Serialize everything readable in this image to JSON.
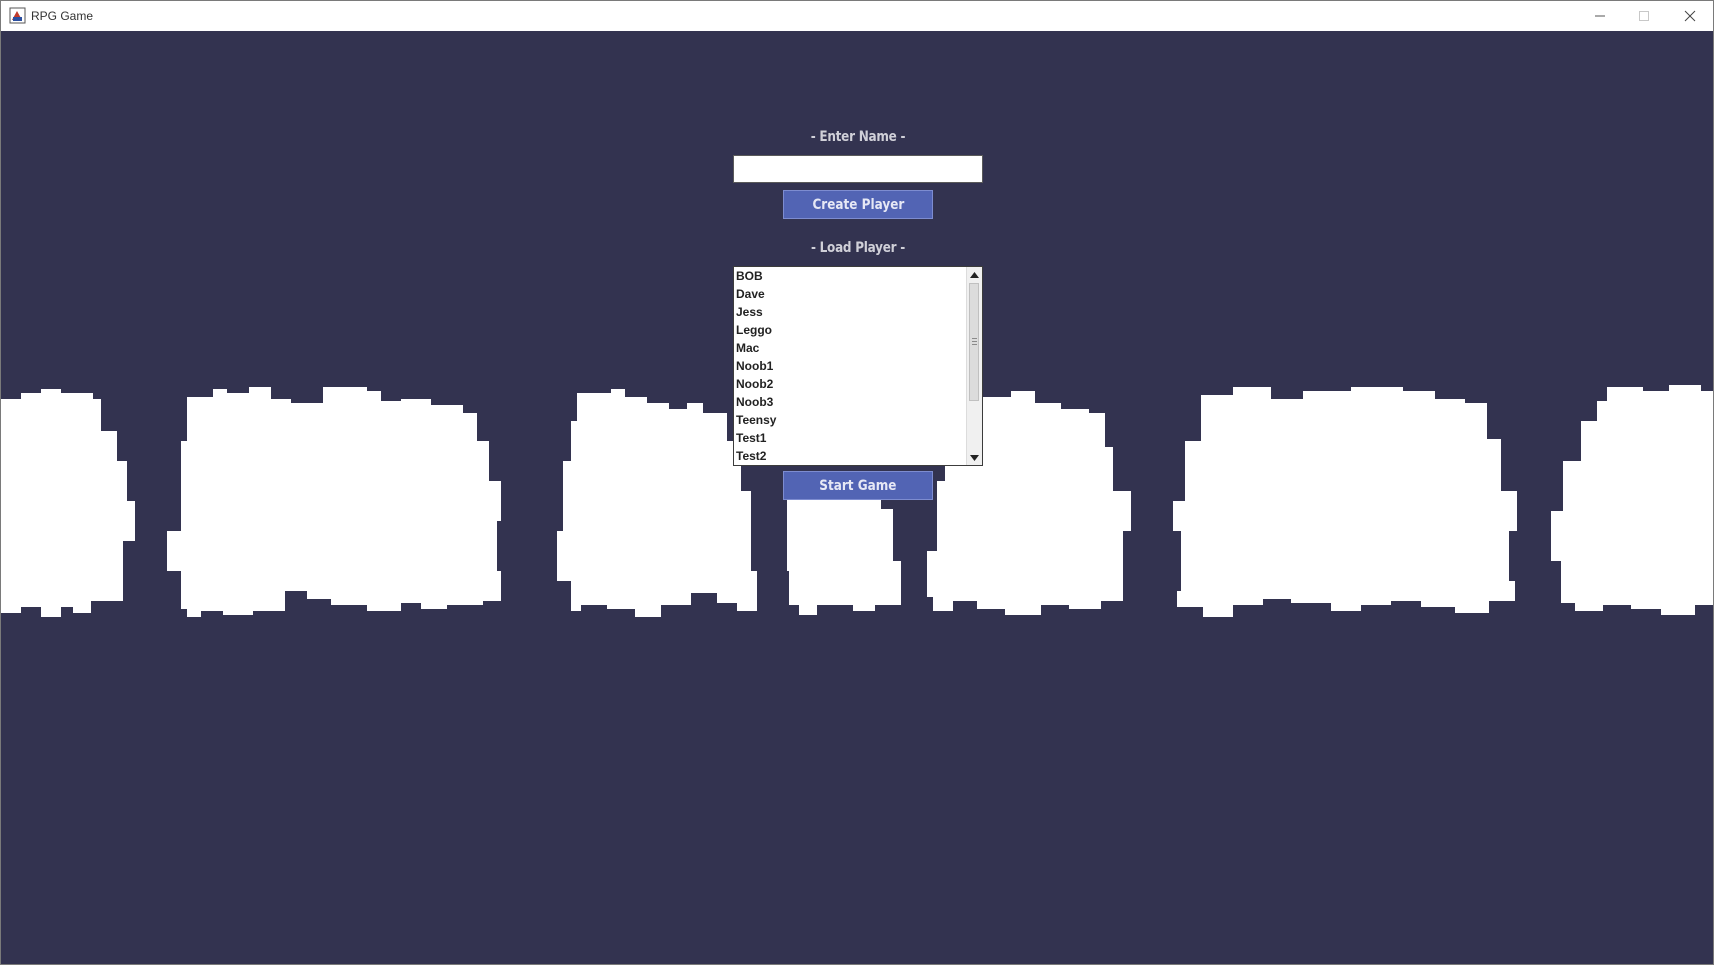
{
  "window": {
    "title": "RPG Game",
    "app_icon": "java-app-icon",
    "controls": [
      "minimize-icon",
      "maximize-icon",
      "close-icon"
    ]
  },
  "menu": {
    "enter_name_heading": "- Enter Name -",
    "name_input_value": "",
    "create_button": "Create Player",
    "load_player_heading": "- Load Player -",
    "players": [
      "BOB",
      "Dave",
      "Jess",
      "Leggo",
      "Mac",
      "Noob1",
      "Noob2",
      "Noob3",
      "Teensy",
      "Test1",
      "Test2"
    ],
    "start_button": "Start Game"
  },
  "colors": {
    "background": "#333350",
    "button": "#5264b4",
    "heading_text": "#d0d0d8",
    "clouds": "#ffffff"
  }
}
